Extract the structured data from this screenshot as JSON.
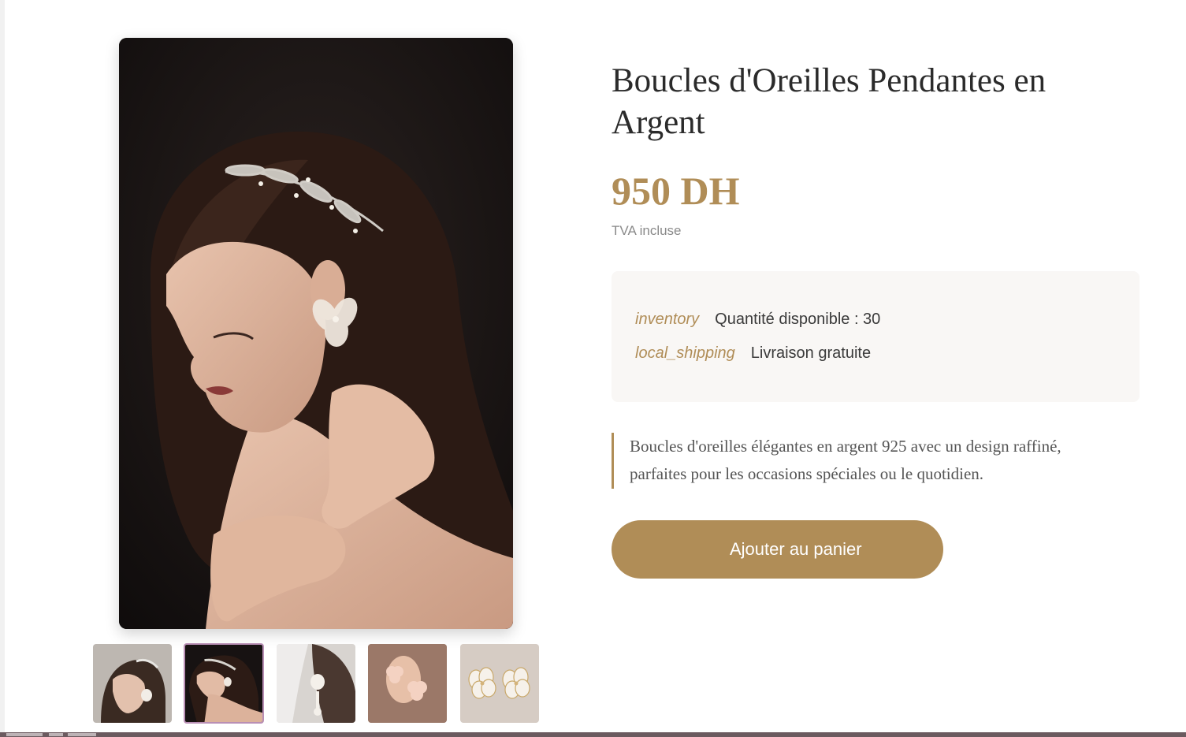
{
  "product": {
    "title": "Boucles d'Oreilles Pendantes en Argent",
    "price": "950 DH",
    "tax_note": "TVA incluse",
    "description": "Boucles d'oreilles élégantes en argent 925 avec un design raffiné, parfaites pour les occasions spéciales ou le quotidien."
  },
  "details": {
    "stock_icon": "inventory",
    "stock_text": "Quantité disponible : 30",
    "shipping_icon": "local_shipping",
    "shipping_text": "Livraison gratuite"
  },
  "cart_button": {
    "label": "Ajouter au panier"
  },
  "gallery": {
    "thumbnail_count": 5,
    "active_index": 2
  },
  "colors": {
    "accent": "#b08d57",
    "title": "#2b2b2b",
    "info_bg": "#f9f7f5",
    "active_thumb_border": "#b98fb5"
  }
}
